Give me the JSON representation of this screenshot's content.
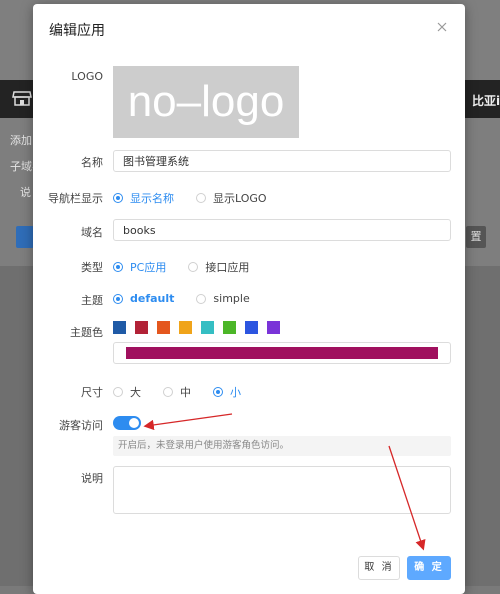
{
  "background": {
    "right_text": "比亚i",
    "lines": [
      "添加",
      "子域名",
      "说"
    ],
    "gray_button": "置"
  },
  "modal": {
    "title": "编辑应用",
    "close_icon": "close-icon",
    "logo": {
      "label": "LOGO",
      "placeholder_text": "no–logo"
    },
    "name": {
      "label": "名称",
      "value": "图书管理系统"
    },
    "navbar": {
      "label": "导航栏显示",
      "options": [
        "显示名称",
        "显示LOGO"
      ],
      "selected": 0
    },
    "domain": {
      "label": "域名",
      "value": "books"
    },
    "type": {
      "label": "类型",
      "options": [
        "PC应用",
        "接口应用"
      ],
      "selected": 0
    },
    "theme": {
      "label": "主题",
      "options": [
        "default",
        "simple"
      ],
      "selected": 0
    },
    "theme_color": {
      "label": "主题色",
      "swatches": [
        "#1f5aa6",
        "#b22237",
        "#e4571e",
        "#f0a41a",
        "#35bec3",
        "#4cb628",
        "#2c55e0",
        "#7a34d8"
      ],
      "current": "#a0105e"
    },
    "size": {
      "label": "尺寸",
      "options": [
        "大",
        "中",
        "小"
      ],
      "selected": 2
    },
    "guest": {
      "label": "游客访问",
      "enabled": true,
      "hint": "开启后，未登录用户使用游客角色访问。"
    },
    "description": {
      "label": "说明",
      "value": ""
    },
    "buttons": {
      "cancel": "取 消",
      "ok": "确 定"
    }
  },
  "colors": {
    "accent": "#2d8cf0",
    "annotation_arrow": "#d62728"
  }
}
